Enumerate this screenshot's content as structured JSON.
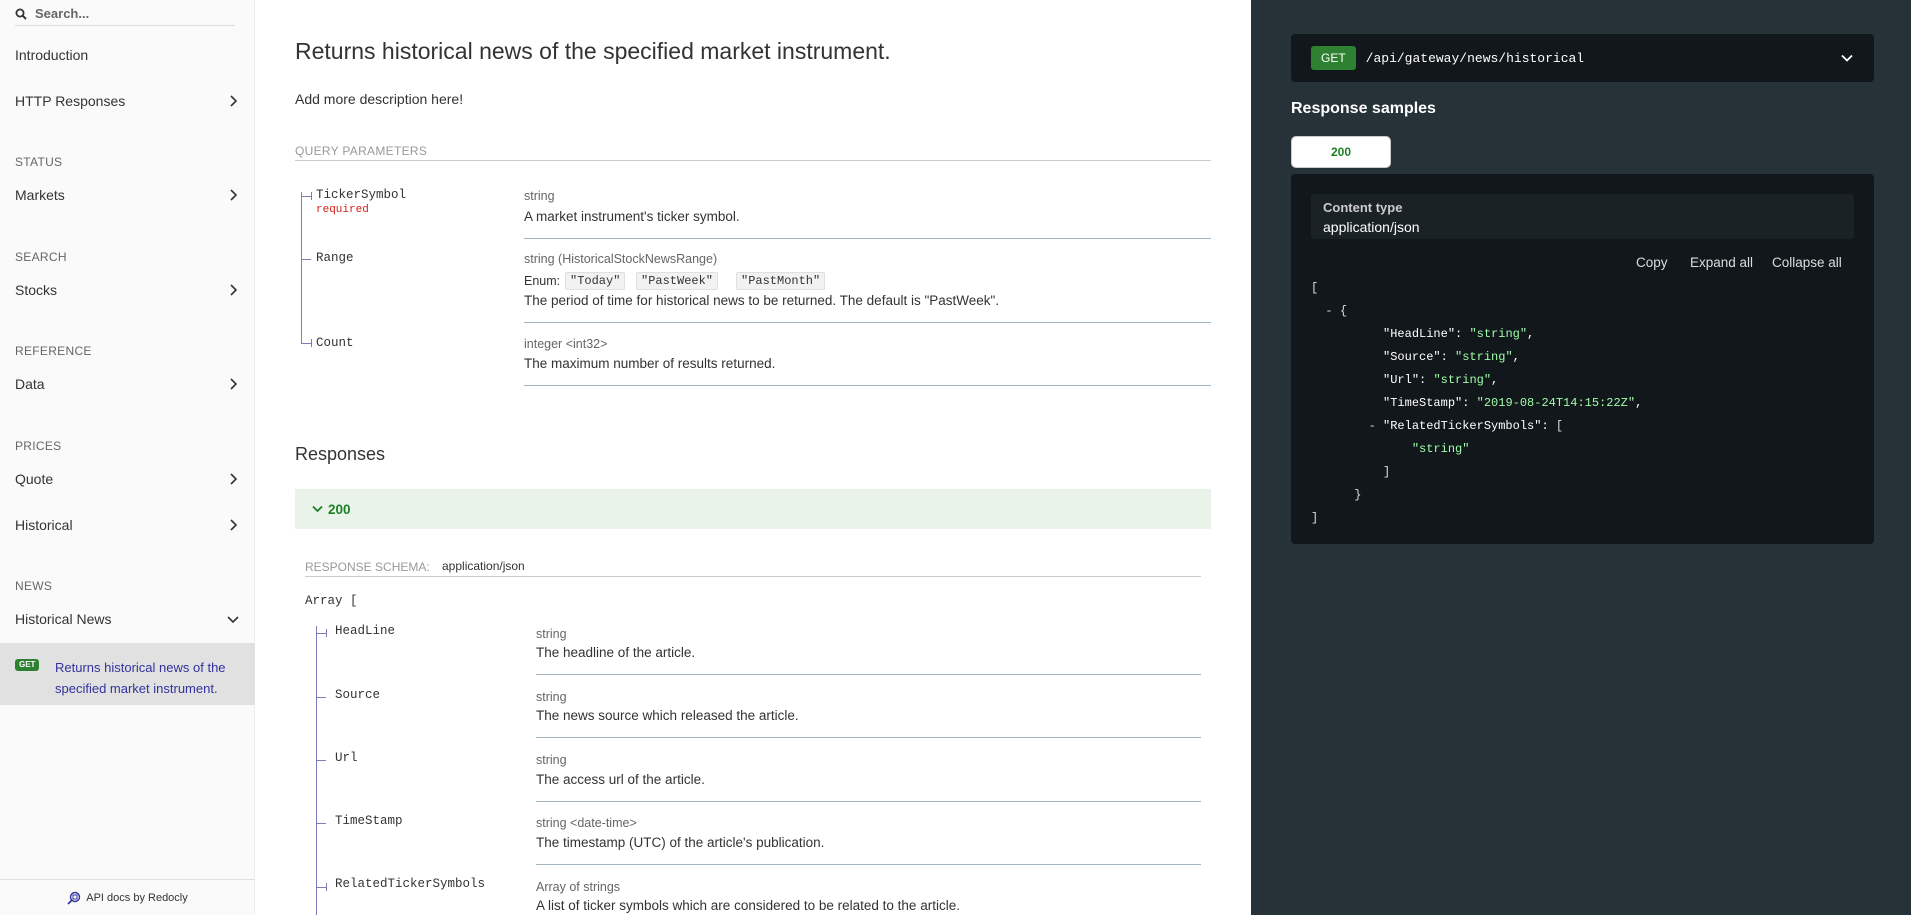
{
  "sidebar": {
    "search_placeholder": "Search...",
    "items": {
      "introduction": "Introduction",
      "http_responses": "HTTP Responses",
      "status_header": "STATUS",
      "markets": "Markets",
      "search_header": "SEARCH",
      "stocks": "Stocks",
      "reference_header": "REFERENCE",
      "data": "Data",
      "prices_header": "PRICES",
      "quote": "Quote",
      "historical": "Historical",
      "news_header": "NEWS",
      "historical_news": "Historical News"
    },
    "active": {
      "badge": "GET",
      "label": "Returns historical news of the specified market instrument."
    },
    "footer": "API docs by Redocly"
  },
  "main": {
    "title": "Returns historical news of the specified market instrument.",
    "description": "Add more description here!",
    "query_header": "QUERY PARAMETERS",
    "params": [
      {
        "name": "TickerSymbol",
        "required": "required",
        "type": "string",
        "desc": "A market instrument's ticker symbol."
      },
      {
        "name": "Range",
        "type": "string (HistoricalStockNewsRange)",
        "enum_label": "Enum:",
        "enums": [
          "\"Today\"",
          "\"PastWeek\"",
          "\"PastMonth\""
        ],
        "desc": "The period of time for historical news to be returned. The default is \"PastWeek\"."
      },
      {
        "name": "Count",
        "type": "integer <int32>",
        "desc": "The maximum number of results returned."
      }
    ],
    "responses_title": "Responses",
    "response_code": "200",
    "schema_label": "RESPONSE SCHEMA:",
    "schema_type": "application/json",
    "array_open": "Array [",
    "fields": [
      {
        "name": "HeadLine",
        "type": "string",
        "desc": "The headline of the article."
      },
      {
        "name": "Source",
        "type": "string",
        "desc": "The news source which released the article."
      },
      {
        "name": "Url",
        "type": "string",
        "desc": "The access url of the article."
      },
      {
        "name": "TimeStamp",
        "type": "string <date-time>",
        "desc": "The timestamp (UTC) of the article's publication."
      },
      {
        "name": "RelatedTickerSymbols",
        "type": "Array of strings",
        "desc": "A list of ticker symbols which are considered to be related to the article."
      }
    ]
  },
  "right": {
    "method": "GET",
    "path": "/api/gateway/news/historical",
    "samples_title": "Response samples",
    "tab": "200",
    "content_type_label": "Content type",
    "content_type": "application/json",
    "copy": "Copy",
    "expand_all": "Expand all",
    "collapse_all": "Collapse all",
    "json": {
      "open_bracket": "[",
      "minus": "-",
      "open_brace": "{",
      "headline_key": "\"HeadLine\"",
      "headline_val": "\"string\"",
      "source_key": "\"Source\"",
      "source_val": "\"string\"",
      "url_key": "\"Url\"",
      "url_val": "\"string\"",
      "timestamp_key": "\"TimeStamp\"",
      "timestamp_val": "\"2019-08-24T14:15:22Z\"",
      "related_key": "\"RelatedTickerSymbols\"",
      "related_open": "[",
      "related_item": "\"string\"",
      "related_close": "]",
      "close_brace": "}",
      "close_bracket": "]"
    }
  },
  "colors": {
    "get_green": "#2F8132",
    "active_link": "#32329f",
    "right_bg": "#263238",
    "string_green": "#a0fbaa"
  }
}
